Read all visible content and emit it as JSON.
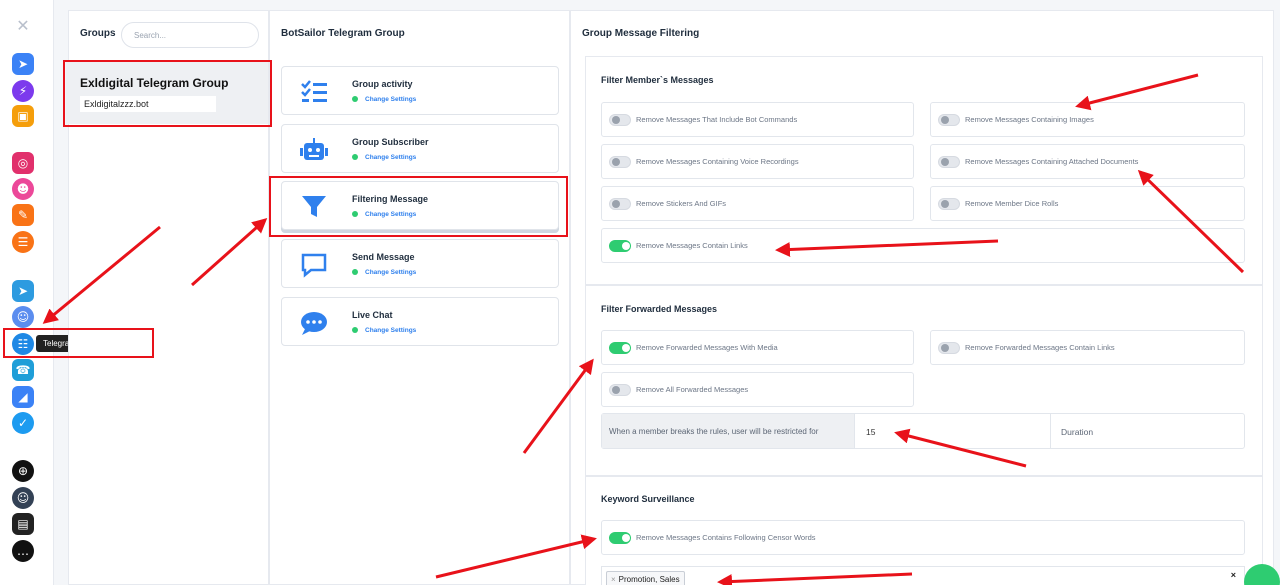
{
  "sidebar": {
    "icons": [
      {
        "name": "brand-logo-icon",
        "color": "#b9c0cc",
        "glyph": "✕"
      },
      {
        "name": "telegram-bot-icon",
        "color": "#3b82f6",
        "glyph": "➤"
      },
      {
        "name": "messenger-icon",
        "color": "#7c3aed",
        "glyph": "⚡"
      },
      {
        "name": "store-icon",
        "color": "#f59e0b",
        "glyph": "▣"
      },
      {
        "name": "instagram-icon",
        "color": "#e1306c",
        "glyph": "◎"
      },
      {
        "name": "bot-icon",
        "color": "#ec4899",
        "glyph": "☻"
      },
      {
        "name": "paint-icon",
        "color": "#f97316",
        "glyph": "✎"
      },
      {
        "name": "chat-icon",
        "color": "#f97316",
        "glyph": "☰"
      },
      {
        "name": "telegram-icon",
        "color": "#2d9be0",
        "glyph": "➤"
      },
      {
        "name": "robot-icon",
        "color": "#5b8def",
        "glyph": "☺"
      },
      {
        "name": "telegram-group-manager-icon",
        "color": "#1e88e5",
        "glyph": "☷"
      },
      {
        "name": "phone-icon",
        "color": "#1f9ed8",
        "glyph": "☎"
      },
      {
        "name": "megaphone-icon",
        "color": "#3b82f6",
        "glyph": "◢"
      },
      {
        "name": "check-icon",
        "color": "#1d9bf0",
        "glyph": "✓"
      },
      {
        "name": "globe-icon",
        "color": "#111111",
        "glyph": "⊕"
      },
      {
        "name": "robot-dark-icon",
        "color": "#334155",
        "glyph": "☺"
      },
      {
        "name": "notebook-icon",
        "color": "#222222",
        "glyph": "▤"
      },
      {
        "name": "speech-bubble-icon",
        "color": "#111111",
        "glyph": "…"
      }
    ],
    "tooltip": "Telegram : Group Manager"
  },
  "groups": {
    "title": "Groups",
    "search_placeholder": "Search...",
    "selected": {
      "name": "Exldigital Telegram Group",
      "username": "Exldigitalzzz.bot"
    }
  },
  "features": {
    "title": "BotSailor Telegram Group",
    "items": [
      {
        "label": "Group activity",
        "settings": "Change Settings",
        "icon": "checklist-icon"
      },
      {
        "label": "Group Subscriber",
        "settings": "Change Settings",
        "icon": "robot-icon"
      },
      {
        "label": "Filtering Message",
        "settings": "Change Settings",
        "icon": "filter-icon"
      },
      {
        "label": "Send Message",
        "settings": "Change Settings",
        "icon": "message-square-icon"
      },
      {
        "label": "Live Chat",
        "settings": "Change Settings",
        "icon": "chat-bubble-icon"
      }
    ]
  },
  "filtering": {
    "title": "Group Message Filtering",
    "members": {
      "title": "Filter Member`s Messages",
      "options": [
        {
          "label": "Remove Messages That Include Bot Commands",
          "on": false
        },
        {
          "label": "Remove Messages Containing Images",
          "on": false
        },
        {
          "label": "Remove Messages Containing Voice Recordings",
          "on": false
        },
        {
          "label": "Remove Messages Containing Attached Documents",
          "on": false
        },
        {
          "label": "Remove Stickers And GIFs",
          "on": false
        },
        {
          "label": "Remove Member Dice Rolls",
          "on": false
        },
        {
          "label": "Remove Messages Contain Links",
          "on": true
        }
      ]
    },
    "forwarded": {
      "title": "Filter Forwarded Messages",
      "options": [
        {
          "label": "Remove Forwarded Messages With Media",
          "on": true
        },
        {
          "label": "Remove Forwarded Messages Contain Links",
          "on": false
        },
        {
          "label": "Remove All Forwarded Messages",
          "on": false
        }
      ],
      "restrict_label": "When a member breaks the rules, user will be restricted for",
      "restrict_value": "15",
      "duration_placeholder": "Duration"
    },
    "keyword": {
      "title": "Keyword Surveillance",
      "option": {
        "label": "Remove Messages Contains Following Censor Words",
        "on": true
      },
      "tag": "Promotion, Sales",
      "tag_remove": "×",
      "clear": "×"
    }
  },
  "colors": {
    "accent": "#2f80ed",
    "toggle_on": "#2ecc71",
    "annotation": "#e8121a"
  }
}
